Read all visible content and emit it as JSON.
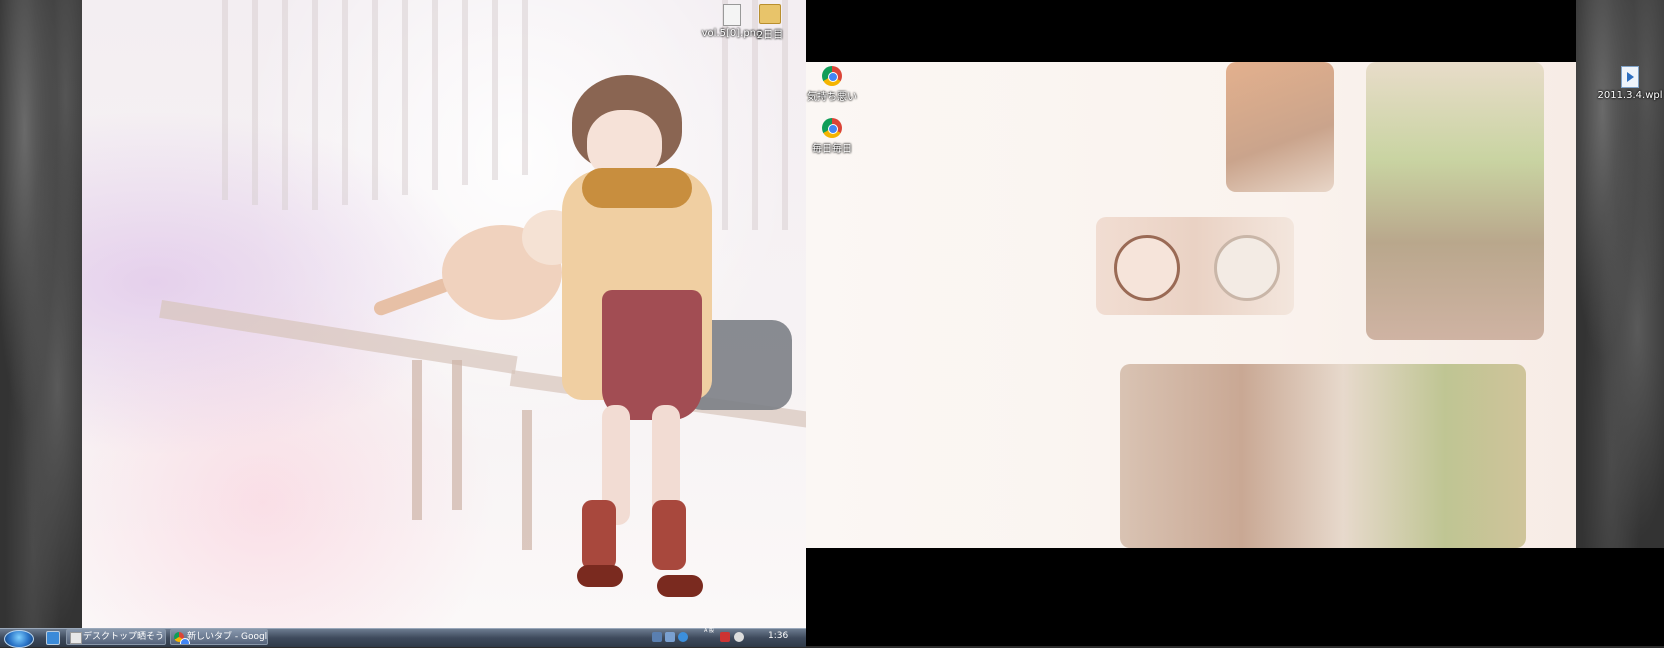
{
  "desktop_icons": [
    {
      "label": "vol.5[0].png",
      "icon": "image-file-icon"
    },
    {
      "label": "2日目",
      "icon": "folder-icon"
    },
    {
      "label": "気持ち悪い",
      "icon": "chrome-icon"
    },
    {
      "label": "毎日毎日",
      "icon": "chrome-icon"
    },
    {
      "label": "2011.3.4.wpl",
      "icon": "media-playlist-icon"
    }
  ],
  "taskbar": {
    "buttons": [
      {
        "label": "デスクトップ晒そう…",
        "icon": "explorer-icon"
      },
      {
        "label": "新しいタブ - Googl…",
        "icon": "chrome-icon"
      }
    ],
    "tray": {
      "language": "A 般",
      "clock": "1:36"
    }
  },
  "colors": {
    "taskbar": "#3e4a5c",
    "desktop_bg_dark": "#333333",
    "wallpaper_main": "#f5f0f2"
  }
}
